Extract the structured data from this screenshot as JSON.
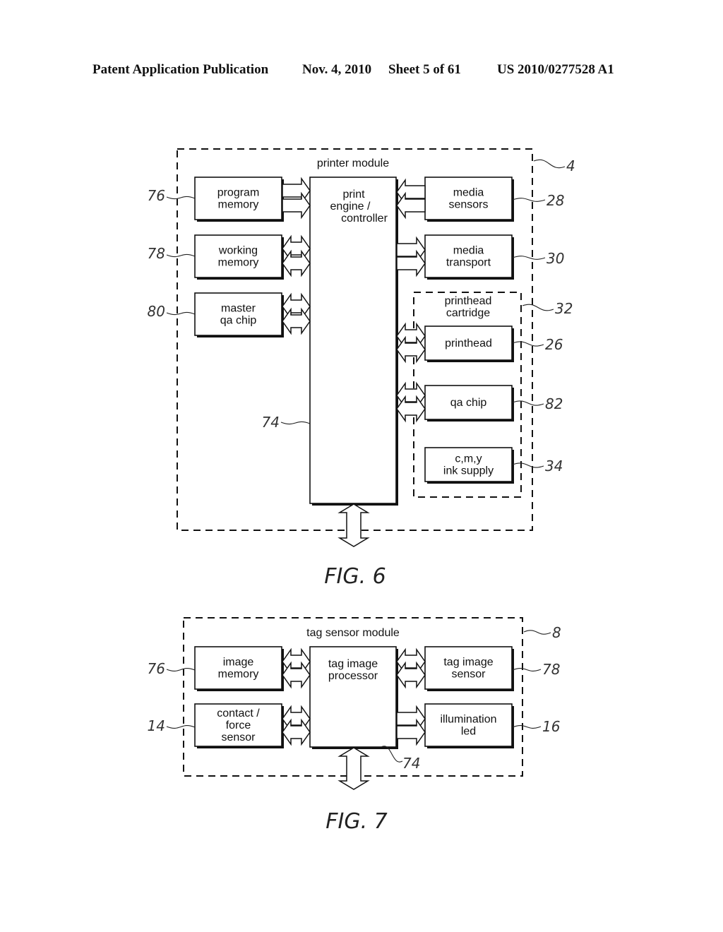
{
  "header": {
    "publication": "Patent Application Publication",
    "date": "Nov. 4, 2010",
    "sheet": "Sheet 5 of 61",
    "number": "US 2010/0277528 A1"
  },
  "figures": [
    {
      "id": "fig6",
      "caption": "FIG. 6",
      "module_label": "printer module",
      "module_ref": "4",
      "controller": {
        "lines": [
          "print",
          "engine /",
          "controller"
        ],
        "ref": "74"
      },
      "left_blocks": [
        {
          "id": "program-memory",
          "lines": [
            "program",
            "memory"
          ],
          "ref": "76",
          "arrow": "to-controller"
        },
        {
          "id": "working-memory",
          "lines": [
            "working",
            "memory"
          ],
          "ref": "78",
          "arrow": "bidirectional"
        },
        {
          "id": "master-qa-chip",
          "lines": [
            "master",
            "qa chip"
          ],
          "ref": "80",
          "arrow": "bidirectional"
        }
      ],
      "right_blocks": [
        {
          "id": "media-sensors",
          "lines": [
            "media",
            "sensors"
          ],
          "ref": "28",
          "arrow": "to-controller"
        },
        {
          "id": "media-transport",
          "lines": [
            "media",
            "transport"
          ],
          "ref": "30",
          "arrow": "from-controller"
        }
      ],
      "sub_module": {
        "label_lines": [
          "printhead",
          "cartridge"
        ],
        "ref": "32",
        "blocks": [
          {
            "id": "printhead",
            "lines": [
              "printhead"
            ],
            "ref": "26",
            "arrow": "bidirectional"
          },
          {
            "id": "qa-chip",
            "lines": [
              "qa chip"
            ],
            "ref": "82",
            "arrow": "bidirectional"
          },
          {
            "id": "ink-supply",
            "lines": [
              "c,m,y",
              "ink supply"
            ],
            "ref": "34",
            "arrow": "none"
          }
        ]
      },
      "external_bus": "bidirectional"
    },
    {
      "id": "fig7",
      "caption": "FIG. 7",
      "module_label": "tag sensor module",
      "module_ref": "8",
      "controller": {
        "lines": [
          "tag image",
          "processor"
        ],
        "ref": "74"
      },
      "left_blocks": [
        {
          "id": "image-memory",
          "lines": [
            "image",
            "memory"
          ],
          "ref": "76",
          "arrow": "bidirectional"
        },
        {
          "id": "contact-force-sensor",
          "lines": [
            "contact /",
            "force",
            "sensor"
          ],
          "ref": "14",
          "arrow": "bidirectional"
        }
      ],
      "right_blocks": [
        {
          "id": "tag-image-sensor",
          "lines": [
            "tag image",
            "sensor"
          ],
          "ref": "78",
          "arrow": "bidirectional"
        },
        {
          "id": "illumination-led",
          "lines": [
            "illumination",
            "led"
          ],
          "ref": "16",
          "arrow": "from-controller"
        }
      ],
      "external_bus": "bidirectional"
    }
  ]
}
